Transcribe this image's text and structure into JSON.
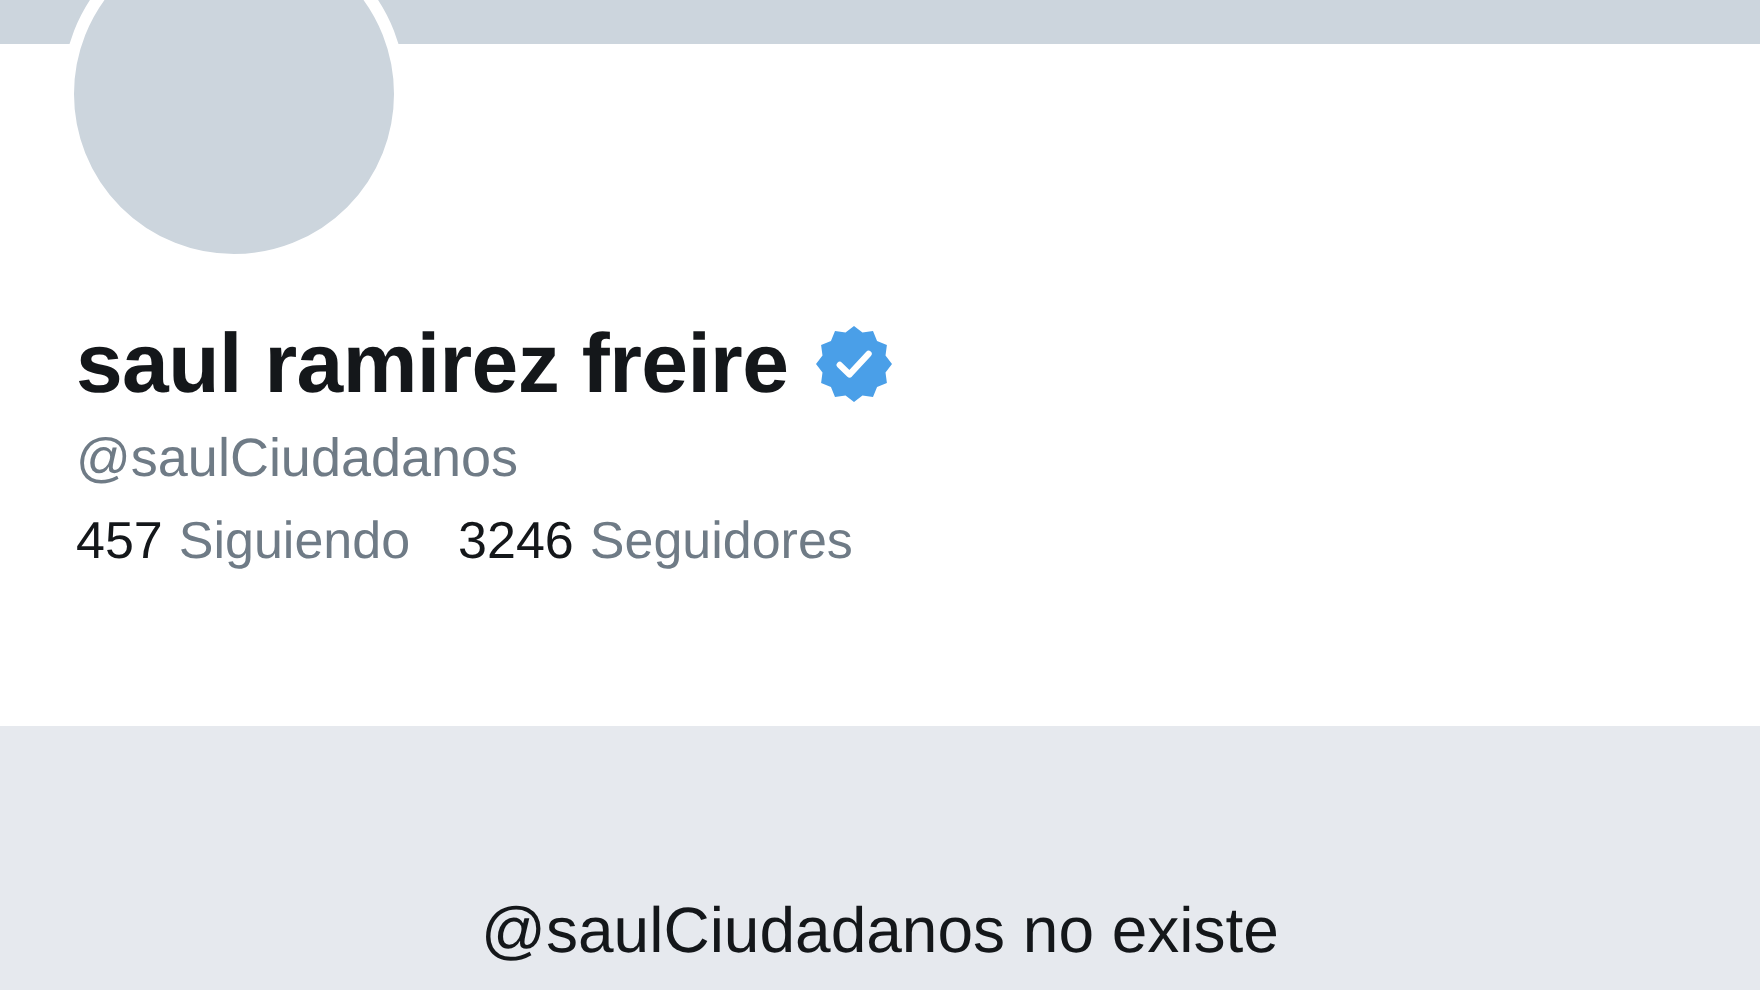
{
  "profile": {
    "name": "saul ramirez freire",
    "handle": "@saulCiudadanos",
    "stats": [
      {
        "count": "457",
        "label": "Siguiendo"
      },
      {
        "count": "3246",
        "label": "Seguidores"
      }
    ]
  },
  "notice": {
    "title": "@saulCiudadanos no existe"
  }
}
